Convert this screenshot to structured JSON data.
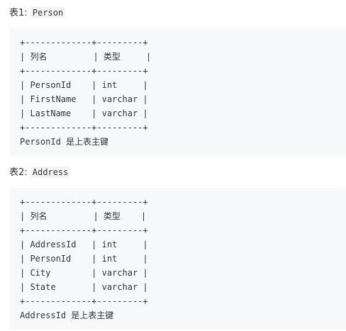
{
  "sections": [
    {
      "heading_label": "表1:",
      "heading_code": "Person",
      "lines": [
        "+-------------+---------+",
        "| 列名         | 类型     |",
        "+-------------+---------+",
        "| PersonId    | int     |",
        "| FirstName   | varchar |",
        "| LastName    | varchar |",
        "+-------------+---------+",
        "PersonId 是上表主键"
      ]
    },
    {
      "heading_label": "表2:",
      "heading_code": "Address",
      "lines": [
        "+-------------+---------+",
        "| 列名         | 类型    |",
        "+-------------+---------+",
        "| AddressId   | int     |",
        "| PersonId    | int     |",
        "| City        | varchar |",
        "| State       | varchar |",
        "+-------------+---------+",
        "AddressId 是上表主键"
      ]
    }
  ]
}
